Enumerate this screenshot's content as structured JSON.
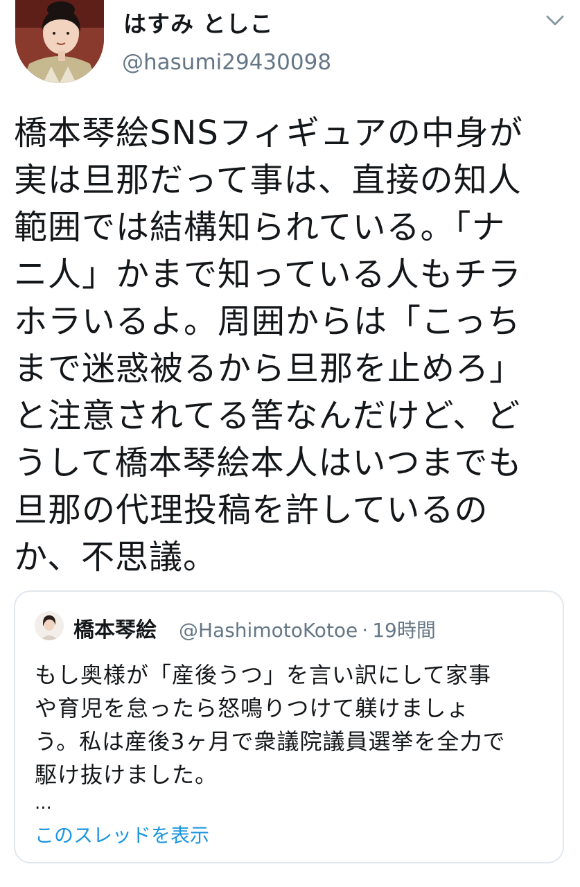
{
  "author": {
    "display_name": "はすみ としこ",
    "handle": "@hasumi29430098"
  },
  "tweet": {
    "text": "橋本琴絵SNSフィギュアの中身が\n実は旦那だって事は、直接の知人\n範囲では結構知られている。「ナ\nニ人」かまで知っている人もチラ\nホラいるよ。周囲からは「こっち\nまで迷惑被るから旦那を止めろ」\nと注意されてる筈なんだけど、ど\nうして橋本琴絵本人はいつまでも\n旦那の代理投稿を許しているの\nか、不思議。"
  },
  "quoted_tweet": {
    "display_name": "橋本琴絵",
    "handle": "@HashimotoKotoe",
    "separator": "·",
    "time": "19時間",
    "text": "もし奥様が「産後うつ」を言い訳にして家事\nや育児を怠ったら怒鳴りつけて躾けましょ\nう。私は産後3ヶ月で衆議院議員選挙を全力で\n駆け抜けました。",
    "ellipsis": "...",
    "show_thread_label": "このスレッドを表示"
  },
  "icons": {
    "menu_caret": "chevron-down-icon",
    "avatar": "avatar",
    "quoted_avatar": "avatar"
  },
  "colors": {
    "primary_text": "#14171a",
    "secondary_text": "#657786",
    "link": "#1b95e0",
    "card_border": "#e1e8ed"
  }
}
